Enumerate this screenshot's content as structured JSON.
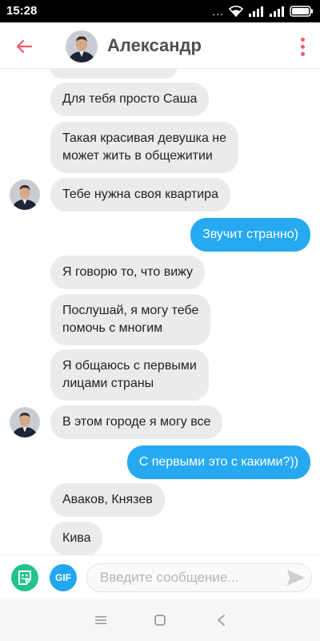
{
  "status_bar": {
    "time": "15:28",
    "dots": "...",
    "icons": [
      "wifi-icon",
      "signal-icon",
      "signal-icon",
      "battery-icon"
    ]
  },
  "header": {
    "title": "Александр",
    "back_icon": "arrow-left-icon",
    "menu_icon": "more-vertical-icon",
    "accent_color": "#ef5b6e"
  },
  "messages": [
    {
      "direction": "in",
      "text": "Для тебя просто Саша"
    },
    {
      "direction": "in",
      "lines": [
        "Такая красивая девушка не",
        "может жить в общежитии"
      ]
    },
    {
      "direction": "in",
      "text": "Тебе нужна своя квартира",
      "avatar": true
    },
    {
      "direction": "out",
      "text": "Звучит странно)"
    },
    {
      "direction": "in",
      "text": "Я говорю то, что вижу"
    },
    {
      "direction": "in",
      "lines": [
        "Послушай, я могу тебе",
        "помочь с многим"
      ]
    },
    {
      "direction": "in",
      "lines": [
        "Я общаюсь с первыми",
        "лицами страны"
      ]
    },
    {
      "direction": "in",
      "text": "В этом городе я могу все",
      "avatar": true
    },
    {
      "direction": "out",
      "text": "С первыми это с какими?))"
    },
    {
      "direction": "in",
      "text": "Аваков, Князев"
    },
    {
      "direction": "in",
      "text": "Кива"
    }
  ],
  "composer": {
    "gif_label": "GIF",
    "placeholder": "Введите сообщение...",
    "sticker_icon": "sticker-icon",
    "send_icon": "send-icon"
  },
  "colors": {
    "incoming_bubble": "#ebebeb",
    "outgoing_bubble": "#26a9f0",
    "sticker_button": "#22c48c",
    "gif_button": "#23a6ef"
  },
  "nav_bar": {
    "icons": [
      "menu-icon",
      "home-square-icon",
      "back-triangle-icon"
    ]
  }
}
